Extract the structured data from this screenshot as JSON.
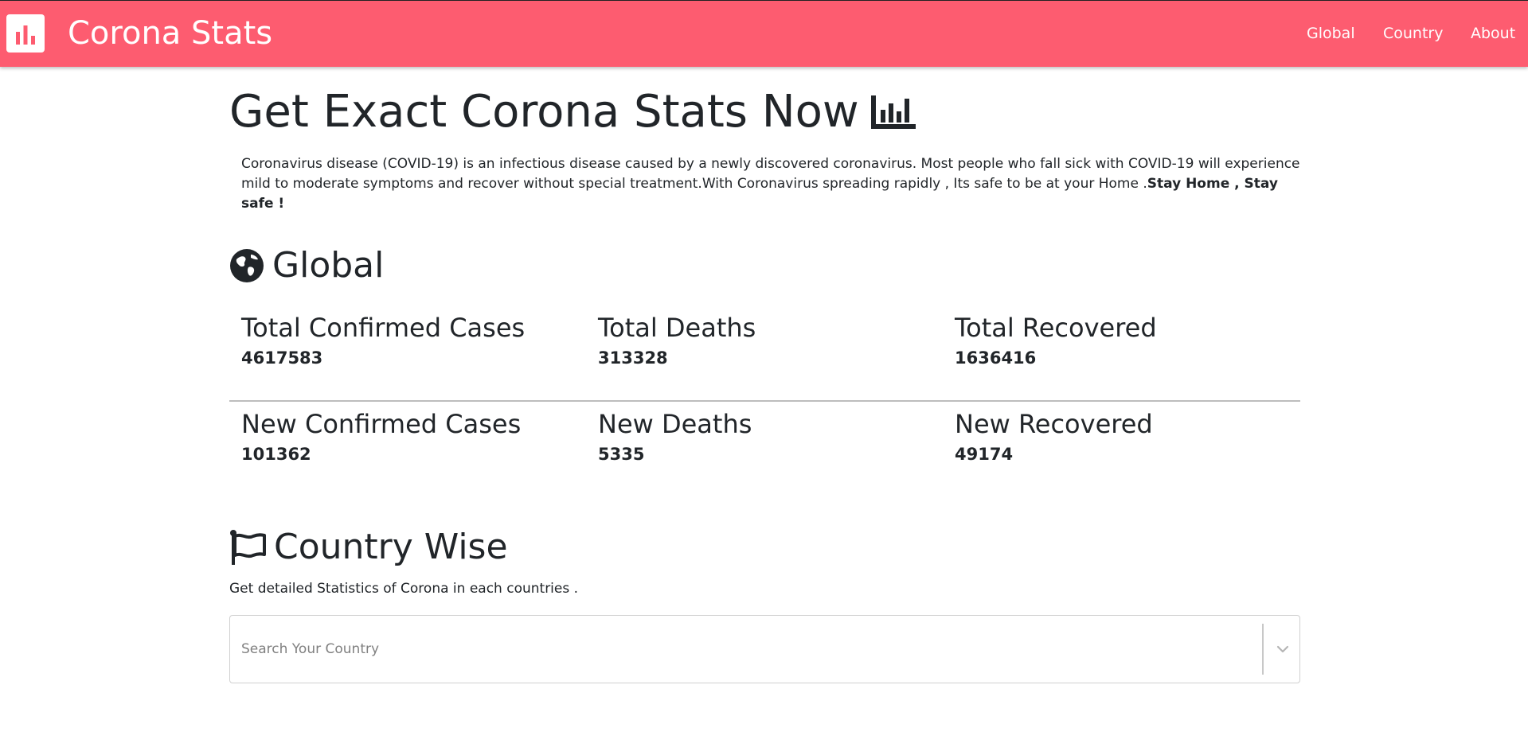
{
  "navbar": {
    "brand_title": "Corona Stats",
    "brand_icon": "bar-chart-icon",
    "links": [
      "Global",
      "Country",
      "About"
    ],
    "color": "#fd5c70"
  },
  "hero": {
    "title": "Get Exact Corona Stats Now",
    "icon": "chart-bar-icon",
    "intro_text": "Coronavirus disease (COVID-19) is an infectious disease caused by a newly discovered coronavirus. Most people who fall sick with COVID-19 will experience mild to moderate symptoms and recover without special treatment.With Coronavirus spreading rapidly , Its safe to be at your Home .",
    "intro_bold": "Stay Home , Stay safe !"
  },
  "global": {
    "title": "Global",
    "icon": "globe-icon",
    "total_confirmed_label": "Total Confirmed Cases",
    "total_confirmed": "4617583",
    "total_deaths_label": "Total Deaths",
    "total_deaths": "313328",
    "total_recovered_label": "Total Recovered",
    "total_recovered": "1636416",
    "new_confirmed_label": "New Confirmed Cases",
    "new_confirmed": "101362",
    "new_deaths_label": "New Deaths",
    "new_deaths": "5335",
    "new_recovered_label": "New Recovered",
    "new_recovered": "49174"
  },
  "country": {
    "title": "Country Wise",
    "icon": "flag-icon",
    "description": "Get detailed Statistics of Corona in each countries .",
    "search_placeholder": "Search Your Country"
  }
}
